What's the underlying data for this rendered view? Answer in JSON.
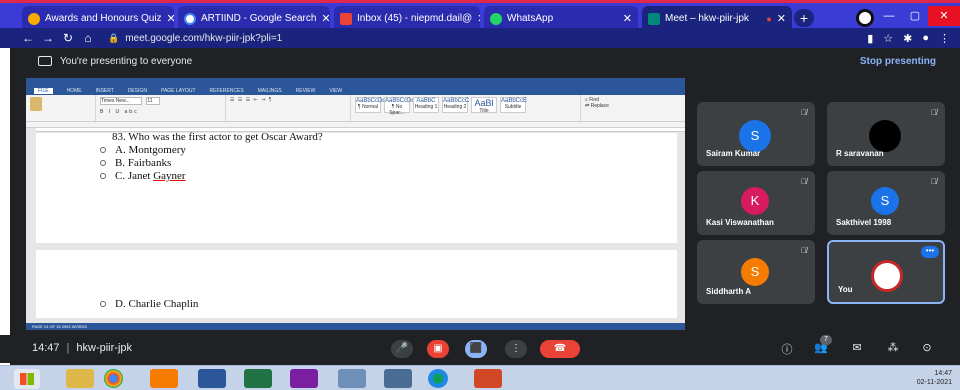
{
  "browser": {
    "tabs": [
      {
        "label": "Awards and Honours Quiz",
        "color": "#f9ab00"
      },
      {
        "label": "ARTIIND - Google Search",
        "color": "#ffffff"
      },
      {
        "label": "Inbox (45) - niepmd.dail@",
        "color": "#ea4335"
      },
      {
        "label": "WhatsApp",
        "color": "#25d366"
      },
      {
        "label": "Meet – hkw-piir-jpk",
        "color": "#00897b"
      }
    ],
    "url": "meet.google.com/hkw-piir-jpk?pli=1"
  },
  "presenting": {
    "label": "You're presenting to everyone",
    "stop": "Stop presenting"
  },
  "document": {
    "question": "83. Who was the first actor to get Oscar Award?",
    "options": [
      "A. Montgomery",
      "B. Fairbanks",
      "C. Janet ",
      "D. Charlie Chaplin"
    ],
    "gayner": "Gayner",
    "ribbon_tabs": [
      "FILE",
      "HOME",
      "INSERT",
      "DESIGN",
      "PAGE LAYOUT",
      "REFERENCES",
      "MAILINGS",
      "REVIEW",
      "VIEW"
    ],
    "styles": [
      {
        "sample": "AaBbCcDc",
        "name": "¶ Normal"
      },
      {
        "sample": "AaBbCcDc",
        "name": "¶ No Spac..."
      },
      {
        "sample": "AaBbC",
        "name": "Heading 1"
      },
      {
        "sample": "AaBbCcC",
        "name": "Heading 2"
      },
      {
        "sample": "AaBl",
        "name": "Title"
      },
      {
        "sample": "AaBbCcE",
        "name": "Subtitle"
      }
    ],
    "font_name": "Times New...",
    "font_size": "11",
    "status": "PAGE 14 OF 15    2943 WORDS"
  },
  "participants": [
    {
      "name": "Sairam Kumar",
      "initial": "S",
      "color": "#1a73e8"
    },
    {
      "name": "R saravanan",
      "initial": "",
      "color": "#000000"
    },
    {
      "name": "Kasi Viswanathan",
      "initial": "K",
      "color": "#d81b60"
    },
    {
      "name": "Sakthivel 1998",
      "initial": "S",
      "color": "#1a73e8"
    },
    {
      "name": "Siddharth A",
      "initial": "S",
      "color": "#f57c00"
    },
    {
      "name": "You",
      "initial": "",
      "color": "#ffffff"
    }
  ],
  "call": {
    "time": "14:47",
    "code": "hkw-piir-jpk",
    "people_count": "7"
  },
  "taskbar": {
    "time": "14:47",
    "date": "02-11-2021"
  }
}
